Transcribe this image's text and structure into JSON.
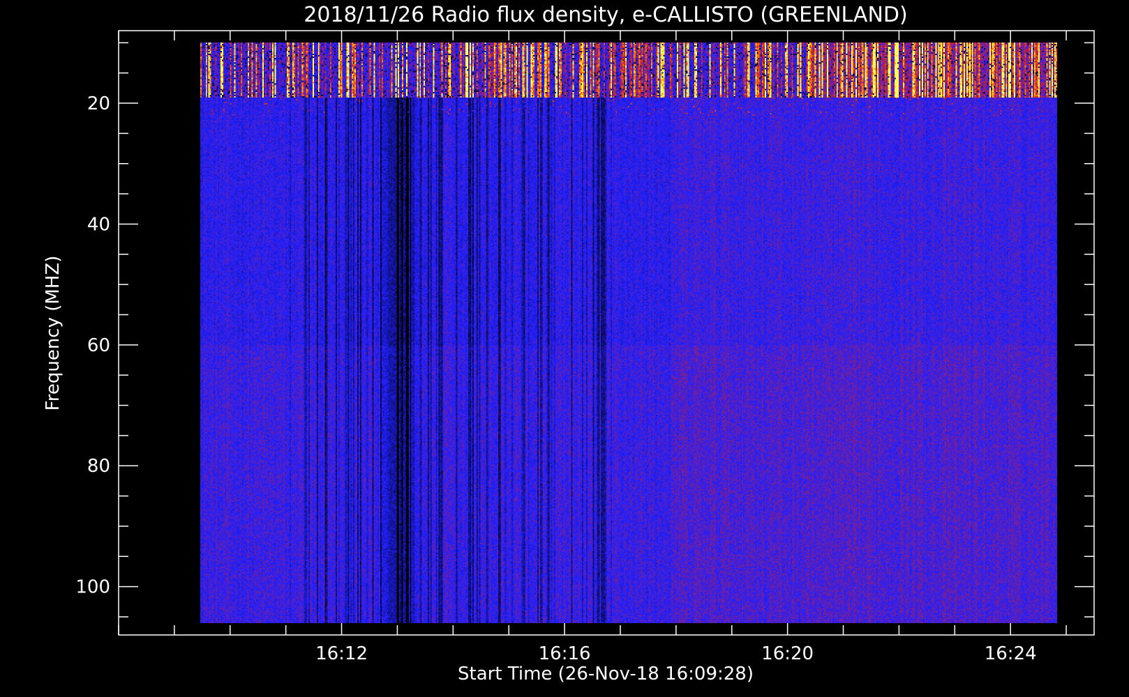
{
  "chart_data": {
    "type": "heatmap",
    "title": "2018/11/26  Radio flux density, e-CALLISTO (GREENLAND)",
    "xlabel": "Start Time (26-Nov-18 16:09:28)",
    "ylabel": "Frequency (MHZ)",
    "x_start": "16:09:28",
    "x_end": "16:24:50",
    "xlim": [
      "16:08:00",
      "16:25:30"
    ],
    "x_ticks": [
      "16:12",
      "16:16",
      "16:20",
      "16:24"
    ],
    "ylim": [
      108,
      8
    ],
    "y_ticks": [
      20,
      40,
      60,
      80,
      100
    ],
    "y_range": [
      10,
      106
    ],
    "grid": false,
    "colors": {
      "background": "#000000",
      "low": "#000000",
      "base": "#2020ff",
      "mid": "#c02040",
      "high": "#ff8000",
      "peak": "#ffff60"
    },
    "features": [
      {
        "label": "strong emission band",
        "y_range": [
          10,
          19
        ]
      },
      {
        "label": "dark column band",
        "x_range": [
          "16:11:00",
          "16:17:00"
        ]
      }
    ]
  }
}
